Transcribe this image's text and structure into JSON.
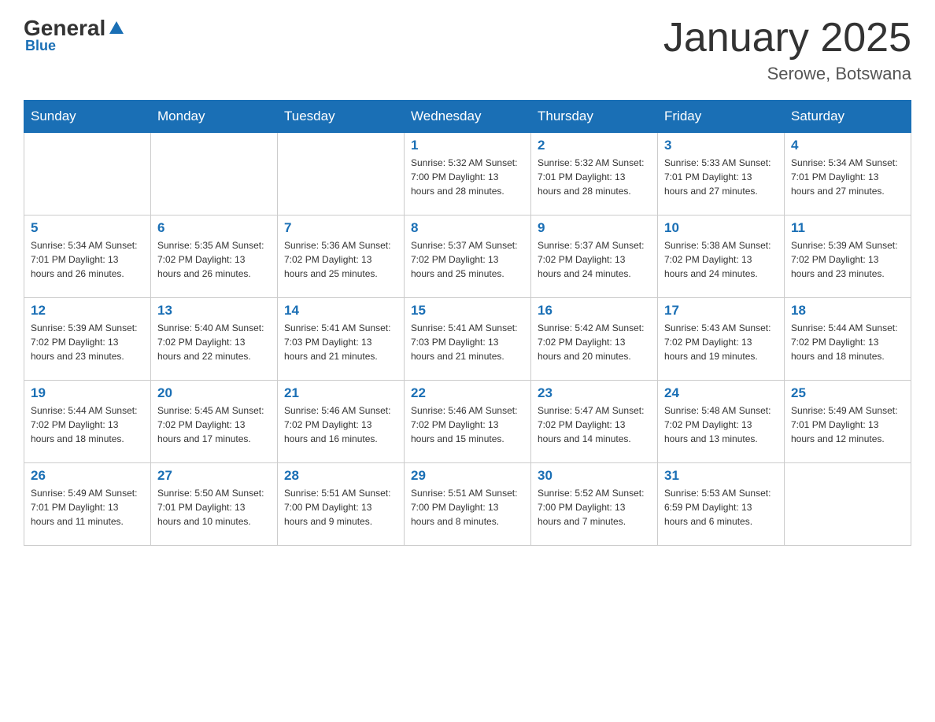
{
  "header": {
    "logo": {
      "general": "General",
      "blue_text": "Blue",
      "subtitle": "Blue"
    },
    "title": "January 2025",
    "location": "Serowe, Botswana"
  },
  "days_of_week": [
    "Sunday",
    "Monday",
    "Tuesday",
    "Wednesday",
    "Thursday",
    "Friday",
    "Saturday"
  ],
  "weeks": [
    [
      {
        "day": "",
        "info": ""
      },
      {
        "day": "",
        "info": ""
      },
      {
        "day": "",
        "info": ""
      },
      {
        "day": "1",
        "info": "Sunrise: 5:32 AM\nSunset: 7:00 PM\nDaylight: 13 hours\nand 28 minutes."
      },
      {
        "day": "2",
        "info": "Sunrise: 5:32 AM\nSunset: 7:01 PM\nDaylight: 13 hours\nand 28 minutes."
      },
      {
        "day": "3",
        "info": "Sunrise: 5:33 AM\nSunset: 7:01 PM\nDaylight: 13 hours\nand 27 minutes."
      },
      {
        "day": "4",
        "info": "Sunrise: 5:34 AM\nSunset: 7:01 PM\nDaylight: 13 hours\nand 27 minutes."
      }
    ],
    [
      {
        "day": "5",
        "info": "Sunrise: 5:34 AM\nSunset: 7:01 PM\nDaylight: 13 hours\nand 26 minutes."
      },
      {
        "day": "6",
        "info": "Sunrise: 5:35 AM\nSunset: 7:02 PM\nDaylight: 13 hours\nand 26 minutes."
      },
      {
        "day": "7",
        "info": "Sunrise: 5:36 AM\nSunset: 7:02 PM\nDaylight: 13 hours\nand 25 minutes."
      },
      {
        "day": "8",
        "info": "Sunrise: 5:37 AM\nSunset: 7:02 PM\nDaylight: 13 hours\nand 25 minutes."
      },
      {
        "day": "9",
        "info": "Sunrise: 5:37 AM\nSunset: 7:02 PM\nDaylight: 13 hours\nand 24 minutes."
      },
      {
        "day": "10",
        "info": "Sunrise: 5:38 AM\nSunset: 7:02 PM\nDaylight: 13 hours\nand 24 minutes."
      },
      {
        "day": "11",
        "info": "Sunrise: 5:39 AM\nSunset: 7:02 PM\nDaylight: 13 hours\nand 23 minutes."
      }
    ],
    [
      {
        "day": "12",
        "info": "Sunrise: 5:39 AM\nSunset: 7:02 PM\nDaylight: 13 hours\nand 23 minutes."
      },
      {
        "day": "13",
        "info": "Sunrise: 5:40 AM\nSunset: 7:02 PM\nDaylight: 13 hours\nand 22 minutes."
      },
      {
        "day": "14",
        "info": "Sunrise: 5:41 AM\nSunset: 7:03 PM\nDaylight: 13 hours\nand 21 minutes."
      },
      {
        "day": "15",
        "info": "Sunrise: 5:41 AM\nSunset: 7:03 PM\nDaylight: 13 hours\nand 21 minutes."
      },
      {
        "day": "16",
        "info": "Sunrise: 5:42 AM\nSunset: 7:02 PM\nDaylight: 13 hours\nand 20 minutes."
      },
      {
        "day": "17",
        "info": "Sunrise: 5:43 AM\nSunset: 7:02 PM\nDaylight: 13 hours\nand 19 minutes."
      },
      {
        "day": "18",
        "info": "Sunrise: 5:44 AM\nSunset: 7:02 PM\nDaylight: 13 hours\nand 18 minutes."
      }
    ],
    [
      {
        "day": "19",
        "info": "Sunrise: 5:44 AM\nSunset: 7:02 PM\nDaylight: 13 hours\nand 18 minutes."
      },
      {
        "day": "20",
        "info": "Sunrise: 5:45 AM\nSunset: 7:02 PM\nDaylight: 13 hours\nand 17 minutes."
      },
      {
        "day": "21",
        "info": "Sunrise: 5:46 AM\nSunset: 7:02 PM\nDaylight: 13 hours\nand 16 minutes."
      },
      {
        "day": "22",
        "info": "Sunrise: 5:46 AM\nSunset: 7:02 PM\nDaylight: 13 hours\nand 15 minutes."
      },
      {
        "day": "23",
        "info": "Sunrise: 5:47 AM\nSunset: 7:02 PM\nDaylight: 13 hours\nand 14 minutes."
      },
      {
        "day": "24",
        "info": "Sunrise: 5:48 AM\nSunset: 7:02 PM\nDaylight: 13 hours\nand 13 minutes."
      },
      {
        "day": "25",
        "info": "Sunrise: 5:49 AM\nSunset: 7:01 PM\nDaylight: 13 hours\nand 12 minutes."
      }
    ],
    [
      {
        "day": "26",
        "info": "Sunrise: 5:49 AM\nSunset: 7:01 PM\nDaylight: 13 hours\nand 11 minutes."
      },
      {
        "day": "27",
        "info": "Sunrise: 5:50 AM\nSunset: 7:01 PM\nDaylight: 13 hours\nand 10 minutes."
      },
      {
        "day": "28",
        "info": "Sunrise: 5:51 AM\nSunset: 7:00 PM\nDaylight: 13 hours\nand 9 minutes."
      },
      {
        "day": "29",
        "info": "Sunrise: 5:51 AM\nSunset: 7:00 PM\nDaylight: 13 hours\nand 8 minutes."
      },
      {
        "day": "30",
        "info": "Sunrise: 5:52 AM\nSunset: 7:00 PM\nDaylight: 13 hours\nand 7 minutes."
      },
      {
        "day": "31",
        "info": "Sunrise: 5:53 AM\nSunset: 6:59 PM\nDaylight: 13 hours\nand 6 minutes."
      },
      {
        "day": "",
        "info": ""
      }
    ]
  ]
}
